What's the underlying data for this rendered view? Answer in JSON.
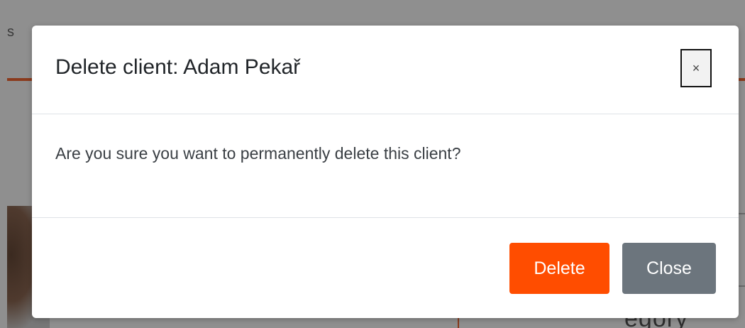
{
  "background": {
    "partial_text": "s",
    "partial_word": "egory",
    "overlay_color": "#8f8f8f"
  },
  "modal": {
    "title": "Delete client: Adam Pekař",
    "close_icon": "×",
    "body_text": "Are you sure you want to permanently delete this client?",
    "delete_label": "Delete",
    "close_label": "Close",
    "colors": {
      "delete_button": "#ff4d00",
      "close_button": "#6c757d"
    }
  }
}
